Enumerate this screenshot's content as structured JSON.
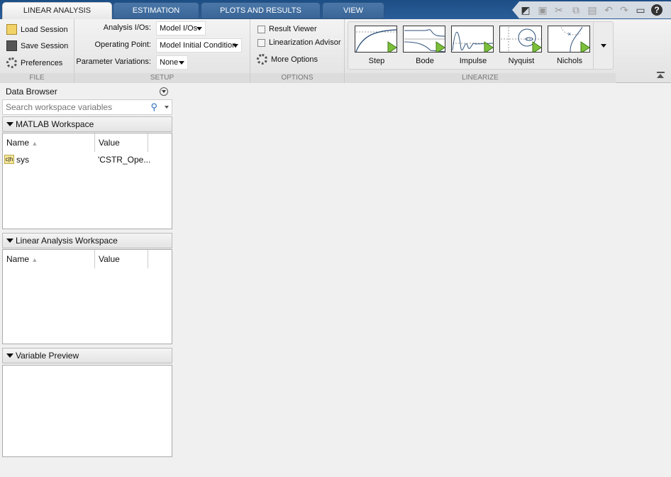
{
  "tabs": [
    {
      "label": "LINEAR ANALYSIS",
      "active": true
    },
    {
      "label": "ESTIMATION"
    },
    {
      "label": "PLOTS AND RESULTS"
    },
    {
      "label": "VIEW"
    }
  ],
  "file": {
    "load": "Load Session",
    "save": "Save Session",
    "prefs": "Preferences",
    "section": "FILE"
  },
  "setup": {
    "io_label": "Analysis I/Os:",
    "io_value": "Model I/Os",
    "op_label": "Operating Point:",
    "op_value": "Model Initial Condition",
    "pv_label": "Parameter Variations:",
    "pv_value": "None",
    "section": "SETUP"
  },
  "options": {
    "result_viewer": "Result Viewer",
    "advisor": "Linearization Advisor",
    "more": "More Options",
    "section": "OPTIONS"
  },
  "linearize": {
    "plots": [
      "Step",
      "Bode",
      "Impulse",
      "Nyquist",
      "Nichols"
    ],
    "section": "LINEARIZE"
  },
  "browser": {
    "title": "Data Browser",
    "search_placeholder": "Search workspace variables",
    "matlab_ws": "MATLAB Workspace",
    "col_name": "Name",
    "col_value": "Value",
    "rows": [
      {
        "name": "sys",
        "value": "'CSTR_Ope..."
      }
    ],
    "lin_ws": "Linear Analysis Workspace",
    "preview": "Variable Preview"
  }
}
